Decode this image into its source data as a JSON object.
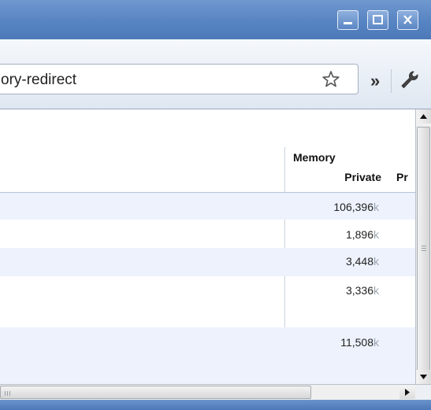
{
  "window": {
    "controls": {
      "minimize": "minimize-icon",
      "maximize": "maximize-icon",
      "close": "close-icon"
    }
  },
  "toolbar": {
    "url_text": "ory-redirect",
    "bookmark_icon": "star-icon",
    "more_label": "»",
    "menu_icon": "wrench-icon"
  },
  "table": {
    "header_group": "Memory",
    "columns": [
      "Private",
      "Pr"
    ],
    "unit": "k",
    "rows": [
      {
        "private": "106,396"
      },
      {
        "private": "1,896"
      },
      {
        "private": "3,448"
      },
      {
        "private": "3,336"
      },
      {
        "private": "11,508"
      }
    ]
  },
  "colors": {
    "title_bar": "#5784c2",
    "row_alt": "#edf2fd",
    "unit_text": "#9aa3b0"
  }
}
